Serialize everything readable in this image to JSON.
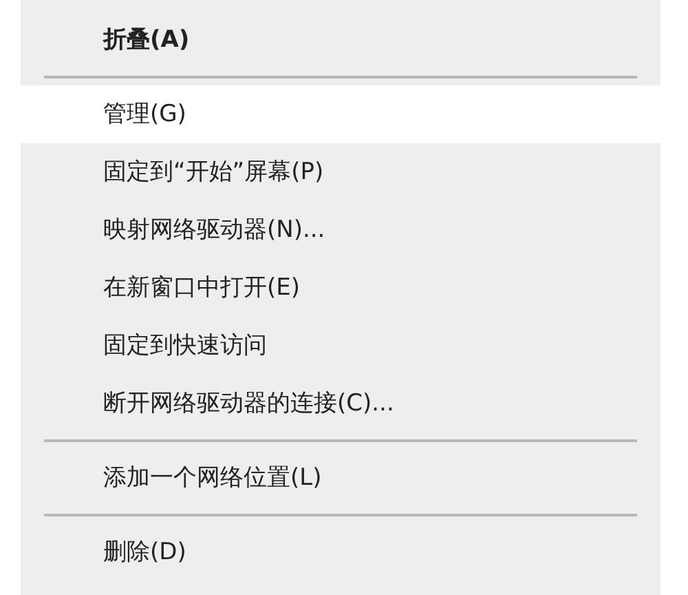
{
  "context_menu": {
    "items": [
      {
        "kind": "item",
        "label": "折叠(A)",
        "default": true,
        "selected": false
      },
      {
        "kind": "separator"
      },
      {
        "kind": "item",
        "label": "管理(G)",
        "default": false,
        "selected": true
      },
      {
        "kind": "item",
        "label": "固定到“开始”屏幕(P)",
        "default": false,
        "selected": false
      },
      {
        "kind": "item",
        "label": "映射网络驱动器(N)...",
        "default": false,
        "selected": false
      },
      {
        "kind": "item",
        "label": "在新窗口中打开(E)",
        "default": false,
        "selected": false
      },
      {
        "kind": "item",
        "label": "固定到快速访问",
        "default": false,
        "selected": false
      },
      {
        "kind": "item",
        "label": "断开网络驱动器的连接(C)...",
        "default": false,
        "selected": false
      },
      {
        "kind": "separator"
      },
      {
        "kind": "item",
        "label": "添加一个网络位置(L)",
        "default": false,
        "selected": false
      },
      {
        "kind": "separator"
      },
      {
        "kind": "item",
        "label": "删除(D)",
        "default": false,
        "selected": false
      }
    ]
  }
}
